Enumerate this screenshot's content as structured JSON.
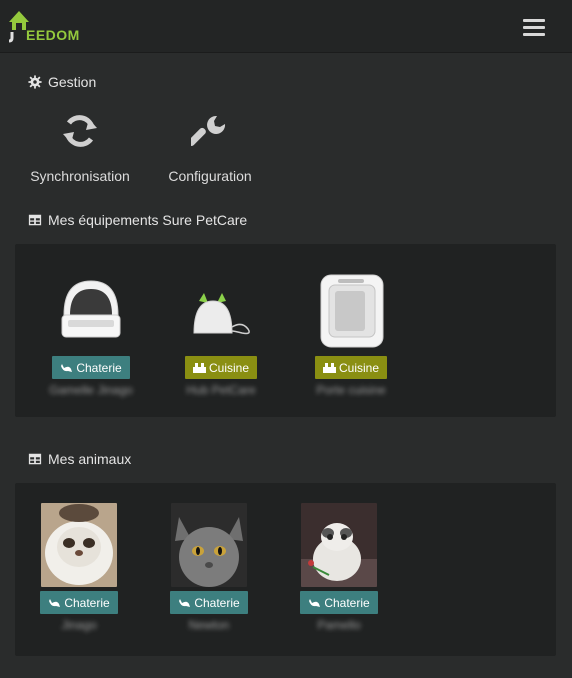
{
  "app": {
    "logo_text": "EEDOM"
  },
  "management": {
    "title": "Gestion",
    "items": [
      {
        "label": "Synchronisation",
        "icon": "sync-icon"
      },
      {
        "label": "Configuration",
        "icon": "wrench-icon"
      }
    ]
  },
  "equipment": {
    "title": "Mes équipements Sure PetCare",
    "items": [
      {
        "room": "Chaterie",
        "room_icon": "cat-icon",
        "name": "Gamelle Jinago",
        "image": "feeder-image"
      },
      {
        "room": "Cuisine",
        "room_icon": "kitchen-icon",
        "name": "Hub PetCare",
        "image": "hub-image"
      },
      {
        "room": "Cuisine",
        "room_icon": "kitchen-icon",
        "name": "Porte cuisine",
        "image": "cat-flap-image"
      }
    ]
  },
  "animals": {
    "title": "Mes animaux",
    "items": [
      {
        "room": "Chaterie",
        "room_icon": "cat-icon",
        "name": "Jinago"
      },
      {
        "room": "Chaterie",
        "room_icon": "cat-icon",
        "name": "Newton"
      },
      {
        "room": "Chaterie",
        "room_icon": "cat-icon",
        "name": "Pamello"
      }
    ]
  },
  "colors": {
    "background": "#2a2c2c",
    "panel": "#202222",
    "teal_badge": "#3d7f7f",
    "olive_badge": "#8a8f12",
    "logo_green": "#94c93d"
  }
}
